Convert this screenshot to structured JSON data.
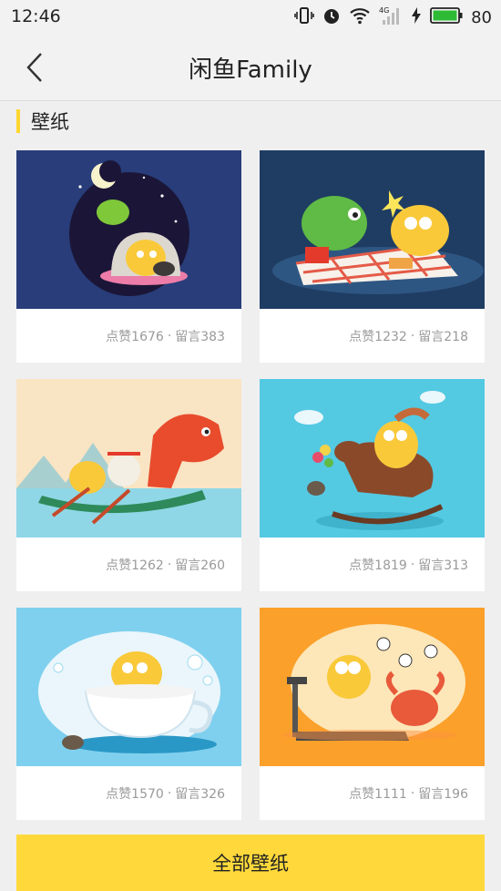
{
  "status_bar": {
    "time": "12:46",
    "battery": "80",
    "network": "4G"
  },
  "nav": {
    "title": "闲鱼Family"
  },
  "section": {
    "title": "壁纸"
  },
  "cards": [
    {
      "likes": "点赞1676",
      "comments": "留言383",
      "bg": "#283d7a"
    },
    {
      "likes": "点赞1232",
      "comments": "留言218",
      "bg": "#1f3d63"
    },
    {
      "likes": "点赞1262",
      "comments": "留言260",
      "bg": "#f9e4c4"
    },
    {
      "likes": "点赞1819",
      "comments": "留言313",
      "bg": "#54c9e2"
    },
    {
      "likes": "点赞1570",
      "comments": "留言326",
      "bg": "#7fd0ee"
    },
    {
      "likes": "点赞1111",
      "comments": "留言196",
      "bg": "#fba02a"
    }
  ],
  "footer": {
    "all_button": "全部壁纸"
  },
  "colors": {
    "accent": "#ffd93b",
    "section_bar": "#ffd630",
    "battery": "#2dbb36"
  }
}
